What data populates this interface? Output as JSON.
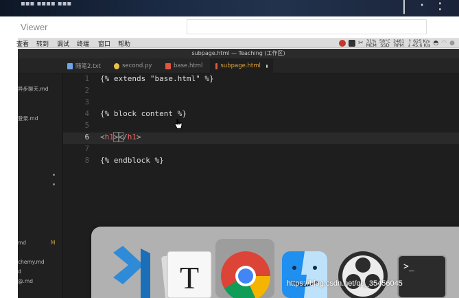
{
  "viewer": {
    "title": "Viewer"
  },
  "menubar": {
    "items": [
      "查看",
      "转到",
      "调试",
      "终端",
      "窗口",
      "帮助"
    ],
    "status": {
      "cpu_pct": "31%",
      "cpu_label": "MEM",
      "temp": "58°C",
      "temp_label": "SSD",
      "rpm": "2481",
      "rpm_label": "RPM",
      "net_up": "↑ 625 K/s",
      "net_down": "↓ 45.6 K/s"
    }
  },
  "editor": {
    "window_title": "subpage.html — Teaching (工作区)",
    "tabs": [
      {
        "label": "随笔2.txt",
        "icon": "text-file-icon",
        "color": "#6ea7e8",
        "active": false
      },
      {
        "label": "second.py",
        "icon": "python-icon",
        "color": "#e8c24a",
        "active": false
      },
      {
        "label": "base.html",
        "icon": "html-icon",
        "color": "#e0573b",
        "active": false
      },
      {
        "label": "subpage.html",
        "icon": "html-icon",
        "color": "#e0573b",
        "active": true,
        "unsaved": true
      }
    ],
    "line_numbers": [
      "1",
      "2",
      "3",
      "4",
      "5",
      "6",
      "7",
      "8"
    ],
    "current_line": "6",
    "lines": {
      "l1": "{% extends \"base.html\" %}",
      "l4": "{% block content %}",
      "l6_open": "<h1>",
      "l6_open_lt": "<",
      "l6_open_name": "h1",
      "l6_open_gt": ">",
      "l6_close_lt": "<",
      "l6_close_slash": "/",
      "l6_close_name": "h1",
      "l6_close_gt": ">",
      "l8": "{% endblock %}"
    }
  },
  "sidebar": {
    "items": [
      "异步聊天.md",
      "登录.md",
      "md",
      "chemy.md",
      "d",
      "@.md"
    ],
    "badge": "M"
  },
  "dock": {
    "apps": [
      "vscode-icon",
      "typora-icon",
      "chrome-icon",
      "finder-icon",
      "obs-icon",
      "terminal-icon"
    ]
  },
  "watermark": "https://blog.csdn.net/qq_35456045",
  "colors": {
    "editor_bg": "#1e1e1e",
    "tab_active": "#e0a33a",
    "html_tag": "#e7645f"
  }
}
